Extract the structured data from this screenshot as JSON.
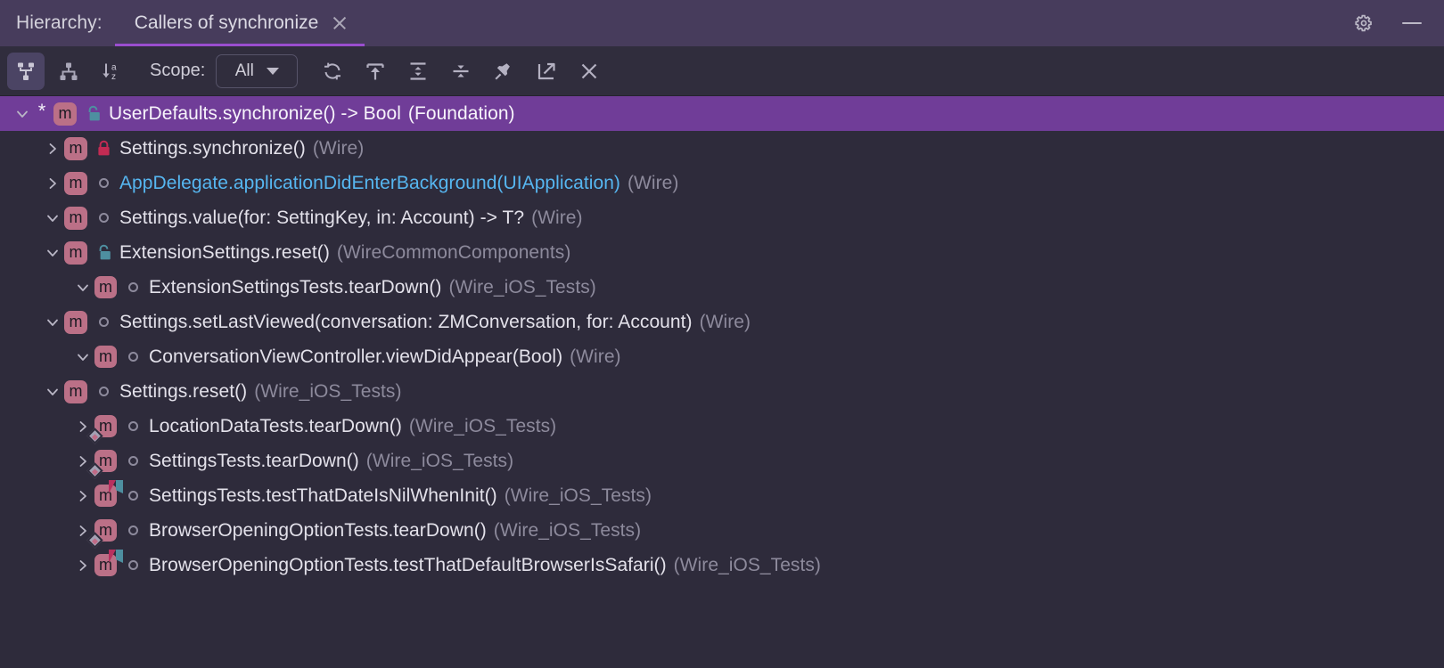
{
  "window": {
    "title_label": "Hierarchy:",
    "settings_icon": "gear-icon",
    "hide_icon": "minimize-dash-icon",
    "tab": {
      "label": "Callers of synchronize",
      "close_icon": "close-icon",
      "active": true,
      "underline_color": "#9a4ecf"
    }
  },
  "toolbar": {
    "buttons": [
      {
        "name": "callers-hierarchy-button",
        "icon": "callers-tree-icon",
        "tooltip": "Callers",
        "selected": true
      },
      {
        "name": "callees-hierarchy-button",
        "icon": "callees-tree-icon",
        "tooltip": "Callees",
        "selected": false
      },
      {
        "name": "sort-alphabetically-button",
        "icon": "sort-alpha-icon",
        "tooltip": "Sort Alphabetically",
        "selected": false
      }
    ],
    "scope": {
      "label": "Scope:",
      "value": "All",
      "options": [
        "All"
      ],
      "caret_icon": "chevron-down-icon"
    },
    "actions": [
      {
        "name": "refresh-button",
        "icon": "refresh-icon",
        "tooltip": "Refresh"
      },
      {
        "name": "export-to-text-button",
        "icon": "export-up-icon",
        "tooltip": "Export to Text File"
      },
      {
        "name": "expand-all-button",
        "icon": "expand-all-icon",
        "tooltip": "Expand All"
      },
      {
        "name": "collapse-all-button",
        "icon": "collapse-all-icon",
        "tooltip": "Collapse All"
      },
      {
        "name": "pin-tab-button",
        "icon": "pin-icon",
        "tooltip": "Pin Tab"
      },
      {
        "name": "open-in-window-button",
        "icon": "open-external-icon",
        "tooltip": "Open in New Window"
      },
      {
        "name": "close-button",
        "icon": "close-icon",
        "tooltip": "Close"
      }
    ]
  },
  "colors": {
    "background": "#2e2b3b",
    "header": "#473c5c",
    "toolbar": "#302d3d",
    "selection": "#703d98",
    "accent": "#9a4ecf",
    "badge": "#bb7087",
    "link": "#56b6f0",
    "module_text": "#8d8a9c",
    "lock_private": "#c32b53",
    "lock_internal": "#4e8fa0"
  },
  "tree": {
    "rows": [
      {
        "indent": 0,
        "twisty": "expanded",
        "star": "*",
        "badge": "m",
        "badge_overlay": "none",
        "visibility": "lock-open-internal",
        "text": "UserDefaults.synchronize() -> Bool",
        "module": "(Foundation)",
        "selected": true,
        "link": false
      },
      {
        "indent": 1,
        "twisty": "collapsed",
        "star": "",
        "badge": "m",
        "badge_overlay": "none",
        "visibility": "lock-closed-private",
        "text": "Settings.synchronize()",
        "module": "(Wire)",
        "selected": false,
        "link": false
      },
      {
        "indent": 1,
        "twisty": "collapsed",
        "star": "",
        "badge": "m",
        "badge_overlay": "none",
        "visibility": "circle-public",
        "text": "AppDelegate.applicationDidEnterBackground(UIApplication)",
        "module": "(Wire)",
        "selected": false,
        "link": true
      },
      {
        "indent": 1,
        "twisty": "expanded",
        "star": "",
        "badge": "m",
        "badge_overlay": "none",
        "visibility": "circle-public",
        "text": "Settings.value<T>(for: SettingKey, in: Account) -> T?",
        "module": "(Wire)",
        "selected": false,
        "link": false
      },
      {
        "indent": 1,
        "twisty": "expanded",
        "star": "",
        "badge": "m",
        "badge_overlay": "none",
        "visibility": "lock-open-internal",
        "text": "ExtensionSettings.reset()",
        "module": "(WireCommonComponents)",
        "selected": false,
        "link": false
      },
      {
        "indent": 2,
        "twisty": "expanded",
        "star": "",
        "badge": "m",
        "badge_overlay": "none",
        "visibility": "circle-public",
        "text": "ExtensionSettingsTests.tearDown()",
        "module": "(Wire_iOS_Tests)",
        "selected": false,
        "link": false
      },
      {
        "indent": 1,
        "twisty": "expanded",
        "star": "",
        "badge": "m",
        "badge_overlay": "none",
        "visibility": "circle-public",
        "text": "Settings.setLastViewed(conversation: ZMConversation, for: Account)",
        "module": "(Wire)",
        "selected": false,
        "link": false
      },
      {
        "indent": 2,
        "twisty": "expanded",
        "star": "",
        "badge": "m",
        "badge_overlay": "none",
        "visibility": "circle-public",
        "text": "ConversationViewController.viewDidAppear(Bool)",
        "module": "(Wire)",
        "selected": false,
        "link": false
      },
      {
        "indent": 1,
        "twisty": "expanded",
        "star": "",
        "badge": "m",
        "badge_overlay": "none",
        "visibility": "circle-public",
        "text": "Settings.reset()",
        "module": "(Wire_iOS_Tests)",
        "selected": false,
        "link": false
      },
      {
        "indent": 2,
        "twisty": "collapsed",
        "star": "",
        "badge": "m",
        "badge_overlay": "diamond",
        "visibility": "circle-public",
        "text": "LocationDataTests.tearDown()",
        "module": "(Wire_iOS_Tests)",
        "selected": false,
        "link": false
      },
      {
        "indent": 2,
        "twisty": "collapsed",
        "star": "",
        "badge": "m",
        "badge_overlay": "diamond",
        "visibility": "circle-public",
        "text": "SettingsTests.tearDown()",
        "module": "(Wire_iOS_Tests)",
        "selected": false,
        "link": false
      },
      {
        "indent": 2,
        "twisty": "collapsed",
        "star": "",
        "badge": "m",
        "badge_overlay": "test",
        "visibility": "circle-public",
        "text": "SettingsTests.testThatDateIsNilWhenInit()",
        "module": "(Wire_iOS_Tests)",
        "selected": false,
        "link": false
      },
      {
        "indent": 2,
        "twisty": "collapsed",
        "star": "",
        "badge": "m",
        "badge_overlay": "diamond",
        "visibility": "circle-public",
        "text": "BrowserOpeningOptionTests.tearDown()",
        "module": "(Wire_iOS_Tests)",
        "selected": false,
        "link": false
      },
      {
        "indent": 2,
        "twisty": "collapsed",
        "star": "",
        "badge": "m",
        "badge_overlay": "test",
        "visibility": "circle-public",
        "text": "BrowserOpeningOptionTests.testThatDefaultBrowserIsSafari()",
        "module": "(Wire_iOS_Tests)",
        "selected": false,
        "link": false
      }
    ]
  }
}
